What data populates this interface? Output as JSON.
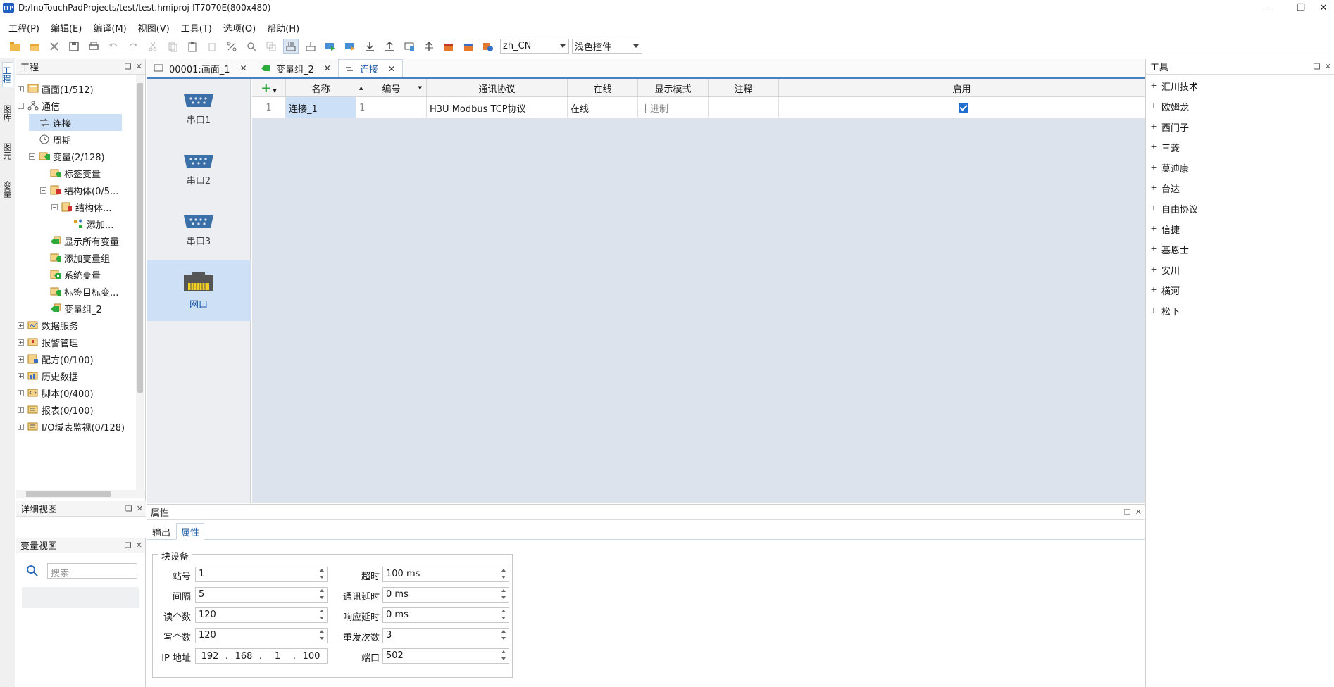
{
  "window": {
    "title": "D:/InoTouchPadProjects/test/test.hmiproj-IT7070E(800x480)",
    "logo": "ITP"
  },
  "menu": [
    "工程(P)",
    "编辑(E)",
    "编译(M)",
    "视图(V)",
    "工具(T)",
    "选项(O)",
    "帮助(H)"
  ],
  "toolbar": {
    "language": "zh_CN",
    "theme": "浅色控件"
  },
  "side_tabs": [
    "工程",
    "图库",
    "图元",
    "变量"
  ],
  "project": {
    "title": "工程",
    "items": [
      {
        "label": "画面(1/512)",
        "indent": 0,
        "exp": "+",
        "icon": "screen"
      },
      {
        "label": "通信",
        "indent": 0,
        "exp": "−",
        "icon": "network"
      },
      {
        "label": "连接",
        "indent": 1,
        "exp": "",
        "icon": "link",
        "selected": true
      },
      {
        "label": "周期",
        "indent": 1,
        "exp": "",
        "icon": "clock"
      },
      {
        "label": "变量(2/128)",
        "indent": 1,
        "exp": "−",
        "icon": "var"
      },
      {
        "label": "标签变量",
        "indent": 2,
        "exp": "",
        "icon": "tag"
      },
      {
        "label": "结构体(0/5...",
        "indent": 2,
        "exp": "−",
        "icon": "struct"
      },
      {
        "label": "结构体...",
        "indent": 3,
        "exp": "−",
        "icon": "struct"
      },
      {
        "label": "添加...",
        "indent": 4,
        "exp": "",
        "icon": "add"
      },
      {
        "label": "显示所有变量",
        "indent": 2,
        "exp": "",
        "icon": "green"
      },
      {
        "label": "添加变量组",
        "indent": 2,
        "exp": "",
        "icon": "tag"
      },
      {
        "label": "系统变量",
        "indent": 2,
        "exp": "",
        "icon": "sys"
      },
      {
        "label": "标签目标变...",
        "indent": 2,
        "exp": "",
        "icon": "tag"
      },
      {
        "label": "变量组_2",
        "indent": 2,
        "exp": "",
        "icon": "green"
      },
      {
        "label": "数据服务",
        "indent": 0,
        "exp": "+",
        "icon": "data"
      },
      {
        "label": "报警管理",
        "indent": 0,
        "exp": "+",
        "icon": "alarm"
      },
      {
        "label": "配方(0/100)",
        "indent": 0,
        "exp": "+",
        "icon": "recipe"
      },
      {
        "label": "历史数据",
        "indent": 0,
        "exp": "+",
        "icon": "history"
      },
      {
        "label": "脚本(0/400)",
        "indent": 0,
        "exp": "+",
        "icon": "script"
      },
      {
        "label": "报表(0/100)",
        "indent": 0,
        "exp": "+",
        "icon": "report"
      },
      {
        "label": "I/O域表监视(0/128)",
        "indent": 0,
        "exp": "+",
        "icon": "report"
      }
    ]
  },
  "detail_view": {
    "title": "详细视图"
  },
  "var_view": {
    "title": "变量视图",
    "search_placeholder": "搜索"
  },
  "doc_tabs": [
    {
      "label": "00001:画面_1",
      "icon": "screen"
    },
    {
      "label": "变量组_2",
      "icon": "green"
    },
    {
      "label": "连接",
      "icon": "link",
      "active": true
    }
  ],
  "ports": [
    {
      "label": "串口1",
      "type": "serial"
    },
    {
      "label": "串口2",
      "type": "serial"
    },
    {
      "label": "串口3",
      "type": "serial"
    },
    {
      "label": "网口",
      "type": "ethernet",
      "selected": true
    }
  ],
  "grid": {
    "add_label": "+",
    "columns": [
      "名称",
      "编号",
      "通讯协议",
      "在线",
      "显示模式",
      "注释",
      "启用"
    ],
    "rows": [
      {
        "index": "1",
        "name": "连接_1",
        "number": "1",
        "protocol": "H3U Modbus TCP协议",
        "online": "在线",
        "display_mode": "十进制",
        "comment": "",
        "enabled": true
      }
    ]
  },
  "tools": {
    "title": "工具",
    "items": [
      "汇川技术",
      "欧姆龙",
      "西门子",
      "三菱",
      "莫迪康",
      "台达",
      "自由协议",
      "信捷",
      "基恩士",
      "安川",
      "横河",
      "松下"
    ]
  },
  "properties": {
    "title": "属性",
    "tabs": [
      "输出",
      "属性"
    ],
    "group": "块设备",
    "fields": {
      "station_label": "站号",
      "station": "1",
      "interval_label": "间隔",
      "interval": "5",
      "read_label": "读个数",
      "read": "120",
      "write_label": "写个数",
      "write": "120",
      "ip_label": "IP 地址",
      "ip": [
        "192",
        "168",
        "1",
        "100"
      ],
      "timeout_label": "超时",
      "timeout": "100 ms",
      "comm_delay_label": "通讯延时",
      "comm_delay": "0 ms",
      "resp_delay_label": "响应延时",
      "resp_delay": "0 ms",
      "retry_label": "重发次数",
      "retry": "3",
      "port_label": "端口",
      "port": "502"
    }
  }
}
